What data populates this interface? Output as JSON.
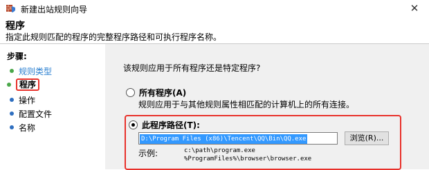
{
  "window": {
    "title": "新建出站规则向导",
    "close_symbol": "✕",
    "app_icon": "firewall-shield-icon"
  },
  "header": {
    "title": "程序",
    "subtitle": "指定此规则匹配的程序的完整程序路径和可执行程序名称。"
  },
  "sidebar": {
    "heading": "步骤:",
    "items": [
      {
        "label": "规则类型",
        "state": "done"
      },
      {
        "label": "程序",
        "state": "current"
      },
      {
        "label": "操作",
        "state": "pending"
      },
      {
        "label": "配置文件",
        "state": "pending"
      },
      {
        "label": "名称",
        "state": "pending"
      }
    ]
  },
  "main": {
    "question": "该规则应用于所有程序还是特定程序?",
    "option_all": {
      "label": "所有程序(A)",
      "description": "规则应用于与其他规则属性相匹配的计算机上的所有连接。",
      "checked": false
    },
    "option_path": {
      "label": "此程序路径(T):",
      "checked": true,
      "value": "D:\\Program Files (x86)\\Tencent\\QQ\\Bin\\QQ.exe",
      "browse_label": "浏览(R)...",
      "example_label": "示例:",
      "example_line1": "c:\\path\\program.exe",
      "example_line2": "%ProgramFiles%\\browser\\browser.exe"
    }
  },
  "colors": {
    "highlight_border": "#e8302a",
    "content_bg": "#f0f0f0",
    "selection": "#3399ff",
    "done_link": "#2a7fd0"
  }
}
